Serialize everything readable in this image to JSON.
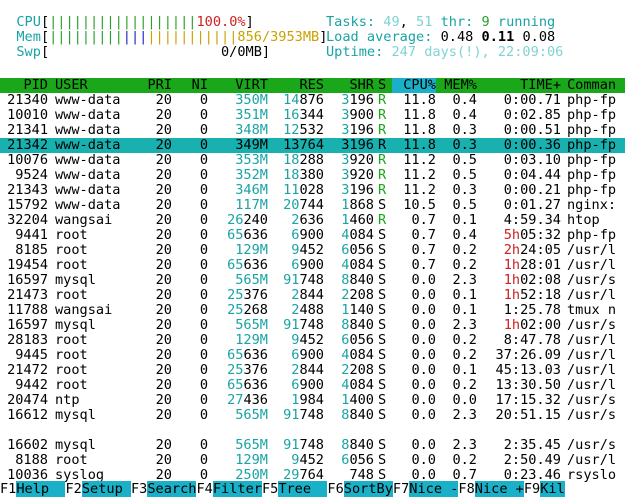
{
  "meters": {
    "cpu": {
      "label": "CPU",
      "bar": "||||||||||||||||||",
      "value": "100.0%"
    },
    "mem": {
      "label": "Mem",
      "bar_g": "|||||||||",
      "bar_b": "|||",
      "bar_y": "|||||||||||",
      "value": "856/3953MB"
    },
    "swp": {
      "label": "Swp",
      "value": "0/0MB"
    }
  },
  "summary": {
    "tasks_label": "Tasks:",
    "tasks": "49",
    "tasks_sep": ", ",
    "threads": "51",
    "thr_label": " thr: ",
    "running": "9",
    "running_label": " running",
    "load_label": "Load average:",
    "load1": "0.48",
    "load5": "0.11",
    "load15": "0.08",
    "uptime_label": "Uptime:",
    "uptime": "247 days(!), 22:09:06"
  },
  "columns": {
    "pid": "PID",
    "user": "USER",
    "pri": "PRI",
    "ni": "NI",
    "virt": "VIRT",
    "res": "RES",
    "shr": "SHR",
    "s": "S",
    "cpu": "CPU%",
    "mem": "MEM%",
    "time": "TIME+",
    "cmd": "Comman"
  },
  "rows": [
    {
      "pid": "21340",
      "user": "www-data",
      "pri": "20",
      "ni": "0",
      "virt": "350M",
      "res": "14876",
      "shr": "3196",
      "s": "R",
      "cpu": "11.8",
      "mem": "0.4",
      "time": "0:00.71",
      "cmd": "php-fp"
    },
    {
      "pid": "10010",
      "user": "www-data",
      "pri": "20",
      "ni": "0",
      "virt": "351M",
      "res": "16344",
      "shr": "3900",
      "s": "R",
      "cpu": "11.8",
      "mem": "0.4",
      "time": "0:02.85",
      "cmd": "php-fp"
    },
    {
      "pid": "21341",
      "user": "www-data",
      "pri": "20",
      "ni": "0",
      "virt": "348M",
      "res": "12532",
      "shr": "3196",
      "s": "R",
      "cpu": "11.8",
      "mem": "0.3",
      "time": "0:00.51",
      "cmd": "php-fp"
    },
    {
      "pid": "21342",
      "user": "www-data",
      "pri": "20",
      "ni": "0",
      "virt": "349M",
      "res": "13764",
      "shr": "3196",
      "s": "R",
      "cpu": "11.8",
      "mem": "0.3",
      "time": "0:00.36",
      "cmd": "php-fp",
      "selected": true
    },
    {
      "pid": "10076",
      "user": "www-data",
      "pri": "20",
      "ni": "0",
      "virt": "353M",
      "res": "18288",
      "shr": "3920",
      "s": "R",
      "cpu": "11.2",
      "mem": "0.5",
      "time": "0:03.10",
      "cmd": "php-fp"
    },
    {
      "pid": "9524",
      "user": "www-data",
      "pri": "20",
      "ni": "0",
      "virt": "352M",
      "res": "18380",
      "shr": "3920",
      "s": "R",
      "cpu": "11.2",
      "mem": "0.5",
      "time": "0:04.44",
      "cmd": "php-fp"
    },
    {
      "pid": "21343",
      "user": "www-data",
      "pri": "20",
      "ni": "0",
      "virt": "346M",
      "res": "11028",
      "shr": "3196",
      "s": "R",
      "cpu": "11.2",
      "mem": "0.3",
      "time": "0:00.21",
      "cmd": "php-fp"
    },
    {
      "pid": "15792",
      "user": "www-data",
      "pri": "20",
      "ni": "0",
      "virt": "117M",
      "res": "20744",
      "shr": "1868",
      "s": "S",
      "cpu": "10.5",
      "mem": "0.5",
      "time": "0:01.27",
      "cmd": "nginx:"
    },
    {
      "pid": "32204",
      "user": "wangsai",
      "pri": "20",
      "ni": "0",
      "virt": "26240",
      "res": "2636",
      "shr": "1460",
      "s": "R",
      "cpu": "0.7",
      "mem": "0.1",
      "time": "4:59.34",
      "cmd": "htop"
    },
    {
      "pid": "9441",
      "user": "root",
      "pri": "20",
      "ni": "0",
      "virt": "65636",
      "res": "6900",
      "shr": "4084",
      "s": "S",
      "cpu": "0.7",
      "mem": "0.4",
      "time": "5h05:32",
      "cmd": "php-fp"
    },
    {
      "pid": "8185",
      "user": "root",
      "pri": "20",
      "ni": "0",
      "virt": "129M",
      "res": "9452",
      "shr": "6056",
      "s": "S",
      "cpu": "0.7",
      "mem": "0.2",
      "time": "2h24:05",
      "cmd": "/usr/l"
    },
    {
      "pid": "19454",
      "user": "root",
      "pri": "20",
      "ni": "0",
      "virt": "65636",
      "res": "6900",
      "shr": "4084",
      "s": "S",
      "cpu": "0.7",
      "mem": "0.2",
      "time": "1h28:01",
      "cmd": "/usr/l"
    },
    {
      "pid": "16597",
      "user": "mysql",
      "pri": "20",
      "ni": "0",
      "virt": "565M",
      "res": "91748",
      "shr": "8840",
      "s": "S",
      "cpu": "0.0",
      "mem": "2.3",
      "time": "1h02:08",
      "cmd": "/usr/s"
    },
    {
      "pid": "21473",
      "user": "root",
      "pri": "20",
      "ni": "0",
      "virt": "25376",
      "res": "2844",
      "shr": "2208",
      "s": "S",
      "cpu": "0.0",
      "mem": "0.1",
      "time": "1h52:18",
      "cmd": "/usr/l"
    },
    {
      "pid": "11788",
      "user": "wangsai",
      "pri": "20",
      "ni": "0",
      "virt": "25268",
      "res": "2488",
      "shr": "1140",
      "s": "S",
      "cpu": "0.0",
      "mem": "0.1",
      "time": "1:25.78",
      "cmd": "tmux n"
    },
    {
      "pid": "16597",
      "user": "mysql",
      "pri": "20",
      "ni": "0",
      "virt": "565M",
      "res": "91748",
      "shr": "8840",
      "s": "S",
      "cpu": "0.0",
      "mem": "2.3",
      "time": "1h02:00",
      "cmd": "/usr/s"
    },
    {
      "pid": "28183",
      "user": "root",
      "pri": "20",
      "ni": "0",
      "virt": "129M",
      "res": "9452",
      "shr": "6056",
      "s": "S",
      "cpu": "0.0",
      "mem": "0.2",
      "time": "8:47.78",
      "cmd": "/usr/l"
    },
    {
      "pid": "9445",
      "user": "root",
      "pri": "20",
      "ni": "0",
      "virt": "65636",
      "res": "6900",
      "shr": "4084",
      "s": "S",
      "cpu": "0.0",
      "mem": "0.2",
      "time": "37:26.09",
      "cmd": "/usr/l"
    },
    {
      "pid": "21472",
      "user": "root",
      "pri": "20",
      "ni": "0",
      "virt": "25376",
      "res": "2844",
      "shr": "2208",
      "s": "S",
      "cpu": "0.0",
      "mem": "0.1",
      "time": "45:13.03",
      "cmd": "/usr/l"
    },
    {
      "pid": "9442",
      "user": "root",
      "pri": "20",
      "ni": "0",
      "virt": "65636",
      "res": "6900",
      "shr": "4084",
      "s": "S",
      "cpu": "0.0",
      "mem": "0.2",
      "time": "13:30.50",
      "cmd": "/usr/l"
    },
    {
      "pid": "20474",
      "user": "ntp",
      "pri": "20",
      "ni": "0",
      "virt": "27436",
      "res": "1984",
      "shr": "1400",
      "s": "S",
      "cpu": "0.0",
      "mem": "0.0",
      "time": "17:15.32",
      "cmd": "/usr/s"
    },
    {
      "pid": "16612",
      "user": "mysql",
      "pri": "20",
      "ni": "0",
      "virt": "565M",
      "res": "91748",
      "shr": "8840",
      "s": "S",
      "cpu": "0.0",
      "mem": "2.3",
      "time": "20:51.15",
      "cmd": "/usr/s"
    },
    {
      "pid": "16602",
      "user": "mysql",
      "pri": "20",
      "ni": "0",
      "virt": "565M",
      "res": "91748",
      "shr": "8840",
      "s": "S",
      "cpu": "0.0",
      "mem": "2.3",
      "time": "2:35.45",
      "cmd": "/usr/s"
    },
    {
      "pid": "8188",
      "user": "root",
      "pri": "20",
      "ni": "0",
      "virt": "129M",
      "res": "9452",
      "shr": "6056",
      "s": "S",
      "cpu": "0.0",
      "mem": "0.2",
      "time": "2:50.49",
      "cmd": "/usr/l"
    },
    {
      "pid": "10036",
      "user": "syslog",
      "pri": "20",
      "ni": "0",
      "virt": "250M",
      "res": "29764",
      "shr": "748",
      "s": "S",
      "cpu": "0.0",
      "mem": "0.7",
      "time": "0:23.46",
      "cmd": "rsyslo"
    }
  ],
  "footer": [
    {
      "key": "F1",
      "label": "Help  "
    },
    {
      "key": "F2",
      "label": "Setup "
    },
    {
      "key": "F3",
      "label": "Search"
    },
    {
      "key": "F4",
      "label": "Filter"
    },
    {
      "key": "F5",
      "label": "Tree  "
    },
    {
      "key": "F6",
      "label": "SortBy"
    },
    {
      "key": "F7",
      "label": "Nice -"
    },
    {
      "key": "F8",
      "label": "Nice +"
    },
    {
      "key": "F9",
      "label": "Kil"
    }
  ]
}
